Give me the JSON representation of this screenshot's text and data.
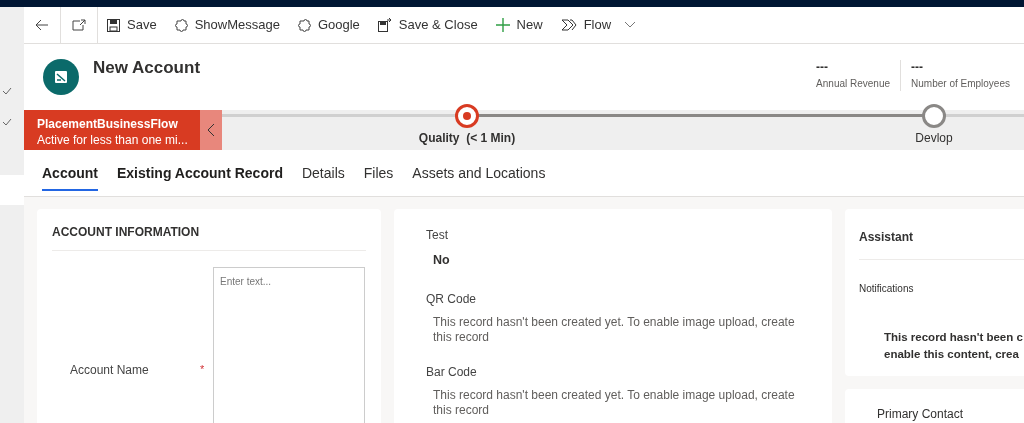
{
  "toolbar": [
    {
      "kind": "back"
    },
    {
      "kind": "popout"
    },
    {
      "label": "Save",
      "kind": "save"
    },
    {
      "label": "ShowMessage",
      "kind": "puzzle"
    },
    {
      "label": "Google",
      "kind": "puzzle"
    },
    {
      "label": "Save & Close",
      "kind": "saveclose"
    },
    {
      "label": "New",
      "kind": "plus"
    },
    {
      "label": "Flow",
      "kind": "flow"
    }
  ],
  "header": {
    "title": "New Account",
    "fields": [
      {
        "value": "---",
        "label": "Annual Revenue"
      },
      {
        "value": "---",
        "label": "Number of Employees"
      }
    ]
  },
  "process": {
    "name": "PlacementBusinessFlow",
    "status": "Active for less than one mi...",
    "stages": [
      {
        "label": "Quality",
        "duration": "(< 1 Min)",
        "active": true
      },
      {
        "label": "Devlop",
        "active": false
      }
    ]
  },
  "tabs": [
    {
      "label": "Account",
      "selected": true
    },
    {
      "label": "Existing Account Record",
      "selected": false
    },
    {
      "label": "Details",
      "selected": false
    },
    {
      "label": "Files",
      "selected": false
    },
    {
      "label": "Assets and Locations",
      "selected": false
    }
  ],
  "account_information": {
    "title": "ACCOUNT INFORMATION",
    "field": {
      "label": "Account Name",
      "required_mark": "*",
      "placeholder": "Enter text..."
    }
  },
  "middle": [
    {
      "label": "Test",
      "value": "No",
      "kind": "value"
    },
    {
      "label": "QR Code",
      "value": "This record hasn't been created yet. To enable image upload, create this record",
      "kind": "note"
    },
    {
      "label": "Bar Code",
      "value": "This record hasn't been created yet. To enable image upload, create this record",
      "kind": "note"
    }
  ],
  "assistant": {
    "title": "Assistant",
    "section": "Notifications",
    "message": [
      "This record hasn't been c",
      "enable this content, crea"
    ]
  },
  "next_card": {
    "title": "Primary Contact"
  }
}
